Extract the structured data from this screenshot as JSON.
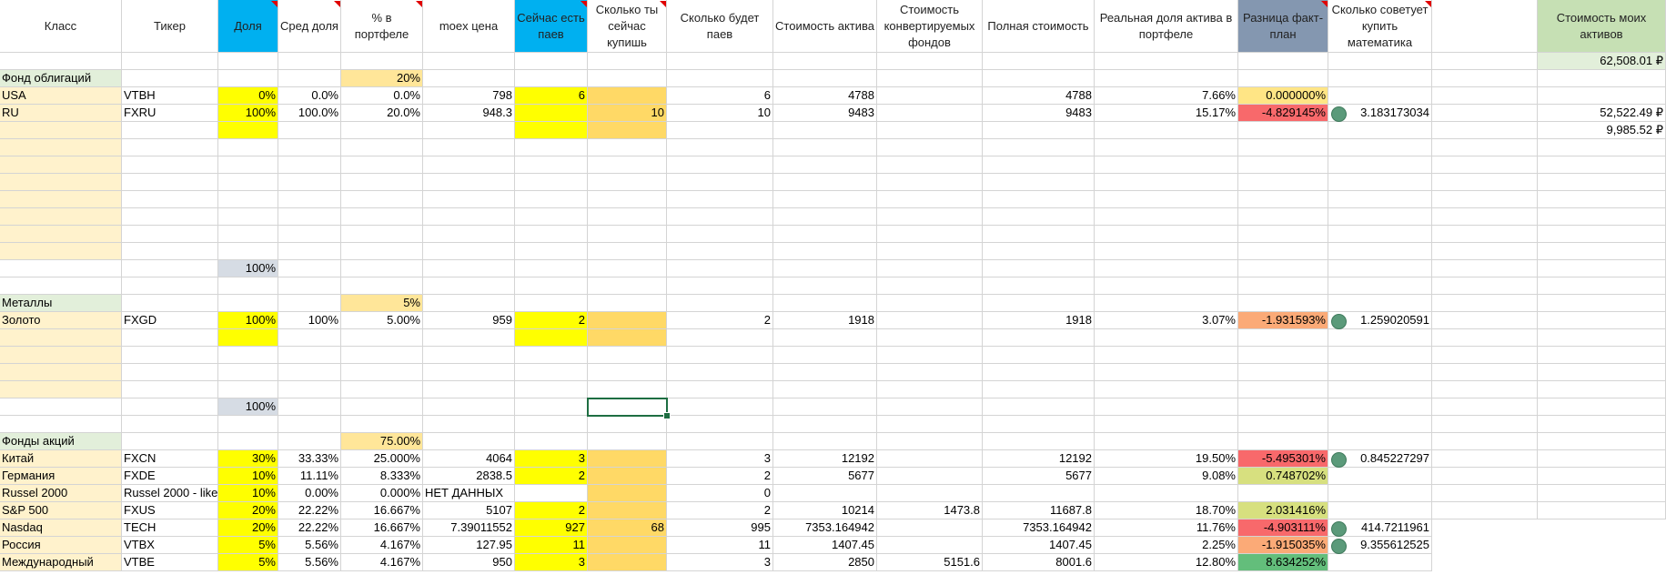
{
  "headers": {
    "klass": "Класс",
    "ticker": "Тикер",
    "dolya": "Доля",
    "sred": "Сред доля",
    "portf": "% в портфеле",
    "moex": "moex цена",
    "now": "Сейчас есть паев",
    "buy": "Сколько ты сейчас купишь",
    "will": "Сколько будет паев",
    "cost": "Стоимость актива",
    "conv": "Стоимость конвертируемых фондов",
    "full": "Полная стоимость",
    "real": "Реальная доля актива в портфеле",
    "diff": "Разница факт-план",
    "advice": "Сколько советует купить математика",
    "assets": "Стоимость моих активов"
  },
  "totals": {
    "assets": "62,508.01 ₽",
    "sub1": "52,522.49 ₽",
    "sub2": "9,985.52 ₽"
  },
  "bonds": {
    "title": "Фонд облигаций",
    "pct": "20%",
    "total": "100%",
    "rows": [
      {
        "klass": "USA",
        "ticker": "VTBH",
        "dolya": "0%",
        "sred": "0.0%",
        "portf": "0.0%",
        "moex": "798",
        "now": "6",
        "buy": "",
        "will": "6",
        "cost": "4788",
        "conv": "",
        "full": "4788",
        "real": "7.66%",
        "diff": "0.000000%",
        "advice": ""
      },
      {
        "klass": "RU",
        "ticker": "FXRU",
        "dolya": "100%",
        "sred": "100.0%",
        "portf": "20.0%",
        "moex": "948.3",
        "now": "",
        "buy": "10",
        "will": "10",
        "cost": "9483",
        "conv": "",
        "full": "9483",
        "real": "15.17%",
        "diff": "-4.829145%",
        "advice": "3.183173034"
      }
    ]
  },
  "metals": {
    "title": "Металлы",
    "pct": "5%",
    "total": "100%",
    "rows": [
      {
        "klass": "Золото",
        "ticker": "FXGD",
        "dolya": "100%",
        "sred": "100%",
        "portf": "5.00%",
        "moex": "959",
        "now": "2",
        "buy": "",
        "will": "2",
        "cost": "1918",
        "conv": "",
        "full": "1918",
        "real": "3.07%",
        "diff": "-1.931593%",
        "advice": "1.259020591"
      }
    ]
  },
  "stocks": {
    "title": "Фонды акций",
    "pct": "75.00%",
    "rows": [
      {
        "klass": "Китай",
        "ticker": "FXCN",
        "dolya": "30%",
        "sred": "33.33%",
        "portf": "25.000%",
        "moex": "4064",
        "now": "3",
        "buy": "",
        "will": "3",
        "cost": "12192",
        "conv": "",
        "full": "12192",
        "real": "19.50%",
        "diff": "-5.495301%",
        "advice": "0.845227297"
      },
      {
        "klass": "Германия",
        "ticker": "FXDE",
        "dolya": "10%",
        "sred": "11.11%",
        "portf": "8.333%",
        "moex": "2838.5",
        "now": "2",
        "buy": "",
        "will": "2",
        "cost": "5677",
        "conv": "",
        "full": "5677",
        "real": "9.08%",
        "diff": "0.748702%",
        "advice": ""
      },
      {
        "klass": "Russel 2000",
        "ticker": "Russel 2000 - like",
        "dolya": "10%",
        "sred": "0.00%",
        "portf": "0.000%",
        "moex": "НЕТ ДАННЫХ",
        "now": "",
        "buy": "",
        "will": "0",
        "cost": "",
        "conv": "",
        "full": "",
        "real": "",
        "diff": "",
        "advice": ""
      },
      {
        "klass": "S&P 500",
        "ticker": "FXUS",
        "dolya": "20%",
        "sred": "22.22%",
        "portf": "16.667%",
        "moex": "5107",
        "now": "2",
        "buy": "",
        "will": "2",
        "cost": "10214",
        "conv": "1473.8",
        "full": "11687.8",
        "real": "18.70%",
        "diff": "2.031416%",
        "advice": ""
      },
      {
        "klass": "Nasdaq",
        "ticker": "TECH",
        "dolya": "20%",
        "sred": "22.22%",
        "portf": "16.667%",
        "moex": "7.39011552",
        "now": "927",
        "buy": "68",
        "will": "995",
        "cost": "7353.164942",
        "conv": "",
        "full": "7353.164942",
        "real": "11.76%",
        "diff": "-4.903111%",
        "advice": "414.7211961"
      },
      {
        "klass": "Россия",
        "ticker": "VTBX",
        "dolya": "5%",
        "sred": "5.56%",
        "portf": "4.167%",
        "moex": "127.95",
        "now": "11",
        "buy": "",
        "will": "11",
        "cost": "1407.45",
        "conv": "",
        "full": "1407.45",
        "real": "2.25%",
        "diff": "-1.915035%",
        "advice": "9.355612525"
      },
      {
        "klass": "Международный",
        "ticker": "VTBE",
        "dolya": "5%",
        "sred": "5.56%",
        "portf": "4.167%",
        "moex": "950",
        "now": "3",
        "buy": "",
        "will": "3",
        "cost": "2850",
        "conv": "5151.6",
        "full": "8001.6",
        "real": "12.80%",
        "diff": "8.634252%",
        "advice": ""
      }
    ]
  },
  "colors": {
    "yellow": "#ffff00",
    "orange": "#ffd966",
    "blue_header": "#00b0f0",
    "grayblue_header": "#8497b0",
    "green_header": "#c6e0b4",
    "cream": "#fff2cc",
    "red_diff": "#f8696b",
    "green_diff": "#63be7b"
  }
}
